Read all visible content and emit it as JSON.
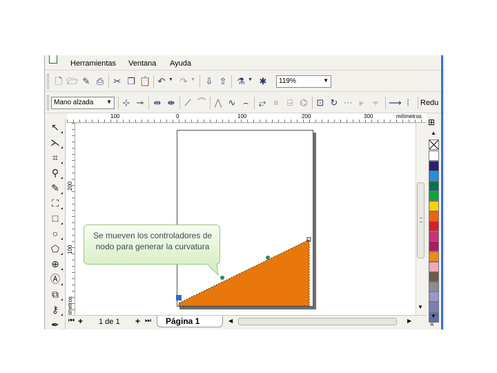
{
  "menubar": {
    "items": [
      "Herramientas",
      "Ventana",
      "Ayuda"
    ]
  },
  "toolbar1": {
    "zoom_value": "119%"
  },
  "toolbar2": {
    "mode_value": "Mano alzada",
    "cut_label": "Redu"
  },
  "ruler": {
    "h_ticks": [
      "100",
      "0",
      "100",
      "200",
      "300"
    ],
    "h_unit": "milímetros",
    "v_ticks": [
      "200",
      "100"
    ],
    "v_unit": "milímetros"
  },
  "navigator": {
    "page_count": "1 de 1",
    "page_tab": "Página 1"
  },
  "callout": {
    "text": "Se mueven los controladores de nodo para generar la curvatura"
  },
  "shape": {
    "fill": "#e8780b"
  },
  "palette": {
    "colors": [
      "#ffffff",
      "#2b1d74",
      "#1f8fdc",
      "#0d6e54",
      "#13a23b",
      "#f4d20a",
      "#e86414",
      "#d4202a",
      "#c8307a",
      "#a81e5e",
      "#e98a1e",
      "#f0a8b5",
      "#6e5a4a",
      "#8b8b95",
      "#9797c9",
      "#7a7fb6",
      "#5b6fa8"
    ]
  }
}
